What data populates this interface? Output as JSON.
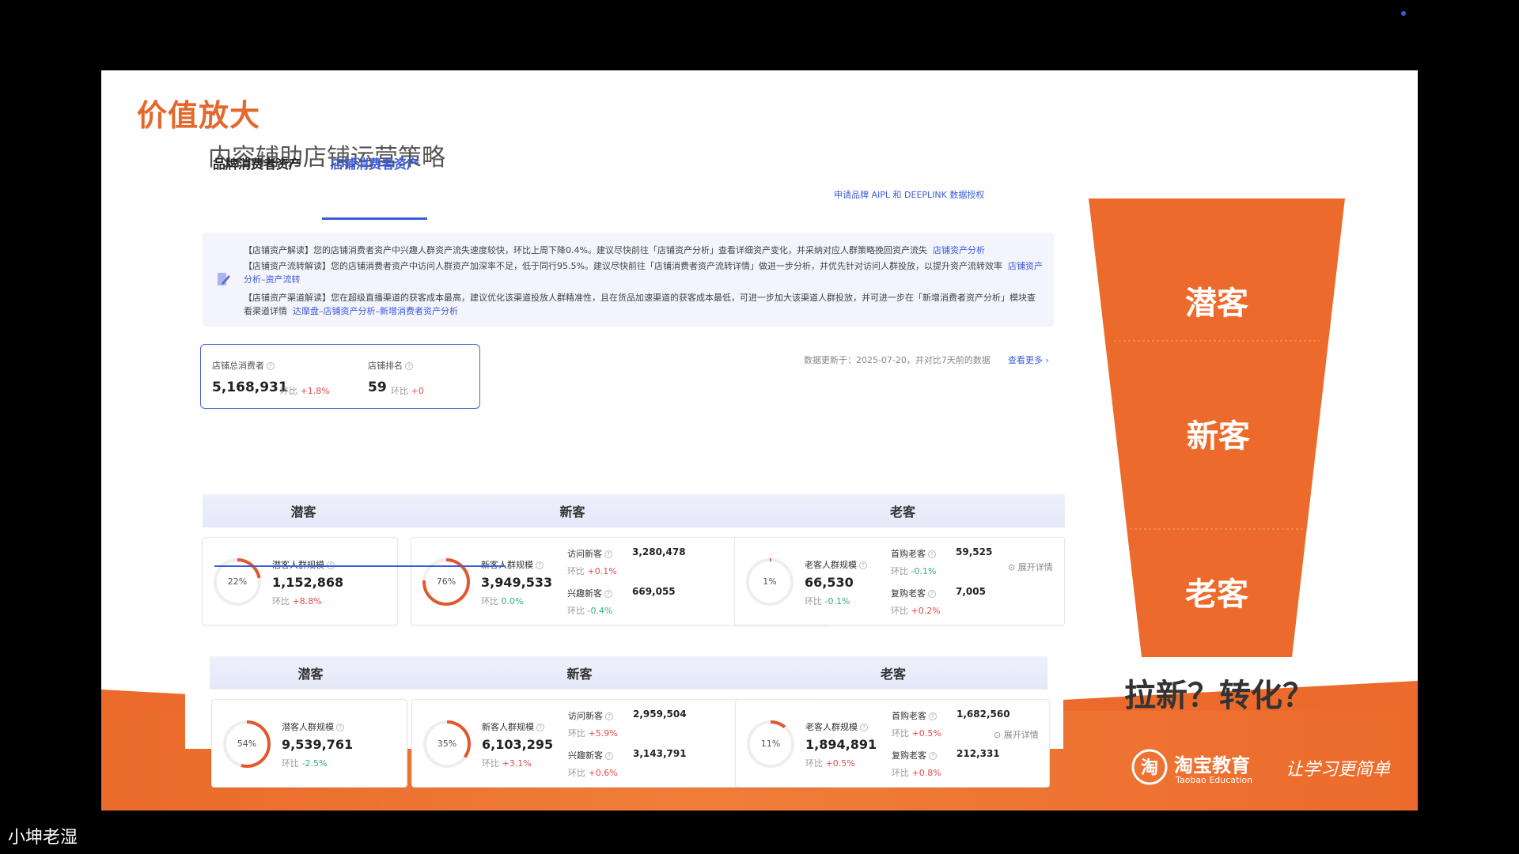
{
  "slide": {
    "title": "价值放大",
    "subtitle": "内容辅助店铺运营策略"
  },
  "tabs": [
    {
      "label": "品牌消费者资产",
      "active": false
    },
    {
      "label": "店铺消费者资产",
      "active": true
    }
  ],
  "apply_link": "申请品牌 AIPL 和 DEEPLINK 数据授权",
  "notices": [
    {
      "text": "【店铺资产解读】您的店铺消费者资产中兴趣人群资产流失速度较快，环比上周下降0.4%。建议尽快前往「店铺资产分析」查看详细资产变化，并采纳对应人群策略挽回资产流失",
      "link": "店铺资产分析"
    },
    {
      "text": "【店铺资产流转解读】您的店铺消费者资产中访问人群资产加深率不足，低于同行95.5%。建议尽快前往「店铺消费者资产流转详情」做进一步分析，并优先针对访问人群投放，以提升资产流转效率",
      "link": "店铺资产分析–资产流转"
    },
    {
      "text": "【店铺资产渠道解读】您在超级直播渠道的获客成本最高，建议优化该渠道投放人群精准性，且在货品加速渠道的获客成本最低，可进一步加大该渠道人群投放，并可进一步在「新增消费者资产分析」模块查看渠道详情",
      "link": "达摩盘–店铺资产分析–新增消费者资产分析"
    }
  ],
  "summary": {
    "total_label": "店铺总消费者",
    "total_value": "5,168,931",
    "total_cmp_label": "环比",
    "total_cmp": "+1.8%",
    "rank_label": "店铺排名",
    "rank_value": "59",
    "rank_cmp_label": "环比",
    "rank_cmp": "+0"
  },
  "update_text": "数据更新于：2025-07-20，并对比7天前的数据",
  "more_link": "查看更多",
  "expand_label": "展开详情",
  "sections": [
    {
      "headers": [
        "潜客",
        "新客",
        "老客"
      ],
      "potential": {
        "pct_value": 22,
        "pct": "22%",
        "label": "潜客人群规模",
        "value": "1,152,868",
        "cmp_label": "环比",
        "cmp": "+8.8%"
      },
      "new": {
        "pct_value": 76,
        "pct": "76%",
        "label": "新客人群规模",
        "value": "3,949,533",
        "cmp_label": "环比",
        "cmp": "0.0%",
        "subs": [
          {
            "label": "访问新客",
            "value": "3,280,478",
            "cmp_label": "环比",
            "cmp": "+0.1%"
          },
          {
            "label": "兴趣新客",
            "value": "669,055",
            "cmp_label": "环比",
            "cmp": "-0.4%"
          }
        ]
      },
      "old": {
        "pct_value": 1,
        "pct": "1%",
        "label": "老客人群规模",
        "value": "66,530",
        "cmp_label": "环比",
        "cmp": "-0.1%",
        "subs": [
          {
            "label": "首购老客",
            "value": "59,525",
            "cmp_label": "环比",
            "cmp": "-0.1%"
          },
          {
            "label": "复购老客",
            "value": "7,005",
            "cmp_label": "环比",
            "cmp": "+0.2%"
          }
        ]
      }
    },
    {
      "headers": [
        "潜客",
        "新客",
        "老客"
      ],
      "potential": {
        "pct_value": 54,
        "pct": "54%",
        "label": "潜客人群规模",
        "value": "9,539,761",
        "cmp_label": "环比",
        "cmp": "-2.5%"
      },
      "new": {
        "pct_value": 35,
        "pct": "35%",
        "label": "新客人群规模",
        "value": "6,103,295",
        "cmp_label": "环比",
        "cmp": "+3.1%",
        "subs": [
          {
            "label": "访问新客",
            "value": "2,959,504",
            "cmp_label": "环比",
            "cmp": "+5.9%"
          },
          {
            "label": "兴趣新客",
            "value": "3,143,791",
            "cmp_label": "环比",
            "cmp": "+0.6%"
          }
        ]
      },
      "old": {
        "pct_value": 11,
        "pct": "11%",
        "label": "老客人群规模",
        "value": "1,894,891",
        "cmp_label": "环比",
        "cmp": "+0.5%",
        "subs": [
          {
            "label": "首购老客",
            "value": "1,682,560",
            "cmp_label": "环比",
            "cmp": "+0.5%"
          },
          {
            "label": "复购老客",
            "value": "212,331",
            "cmp_label": "环比",
            "cmp": "+0.8%"
          }
        ]
      }
    }
  ],
  "funnel": {
    "stages": [
      "潜客",
      "新客",
      "老客"
    ],
    "color": "#ec6b2c",
    "question": "拉新？转化？"
  },
  "brand": {
    "name_cn": "淘宝教育",
    "name_en": "Taobao Education",
    "slogan": "让学习更简单",
    "logo_char": "淘"
  },
  "watermark": "小坤老湿",
  "colors": {
    "accent": "#3b5bdb",
    "brand": "#ec6b2c",
    "up": "#e64a4a",
    "down": "#2fb36d",
    "ring": "#e4572e"
  }
}
